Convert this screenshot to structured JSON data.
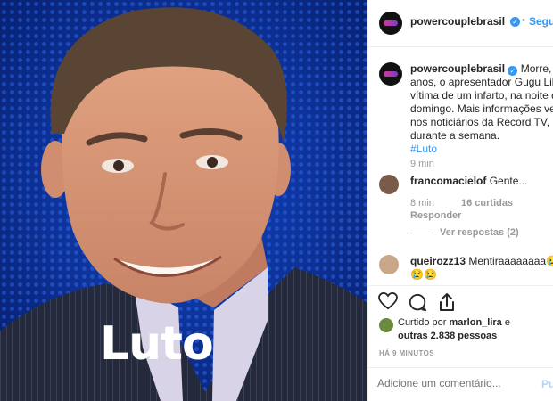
{
  "photo": {
    "overlay_text": "Luto"
  },
  "header": {
    "username": "powercouplebrasil",
    "dot": "•",
    "follow_label": "Seguir"
  },
  "caption": {
    "username": "powercouplebrasil",
    "lines": [
      "Morre, aos",
      "anos, o apresentador Gugu Liber",
      "vítima de um infarto, na noite des",
      "domingo. Mais informações vejan",
      "nos noticiários da Record TV,",
      "durante a semana."
    ],
    "hashtag": "#Luto",
    "time": "9 min"
  },
  "comments": [
    {
      "username": "francomacielof",
      "text": "Gente...",
      "time": "8 min",
      "likes": "16 curtidas",
      "reply_label": "Responder",
      "view_replies": "Ver respostas (2)"
    },
    {
      "username": "queirozz13",
      "text": "Mentiraaaaaaaa😢",
      "text_line2": "😢😢"
    }
  ],
  "likes": {
    "prefix": "Curtido por",
    "user": "marlon_lira",
    "conj": "e",
    "others": "outras 2.838 pessoas"
  },
  "timestamp": "HÁ 9 MINUTOS",
  "comment_box": {
    "placeholder": "Adicione um comentário...",
    "publish_label": "Pu"
  },
  "icons": [
    "heart-icon",
    "comment-icon",
    "share-icon",
    "verified-icon"
  ],
  "colors": {
    "link_blue": "#3897f0",
    "text": "#262626",
    "meta_gray": "#999999",
    "photo_bg": "#0a2a8a"
  }
}
